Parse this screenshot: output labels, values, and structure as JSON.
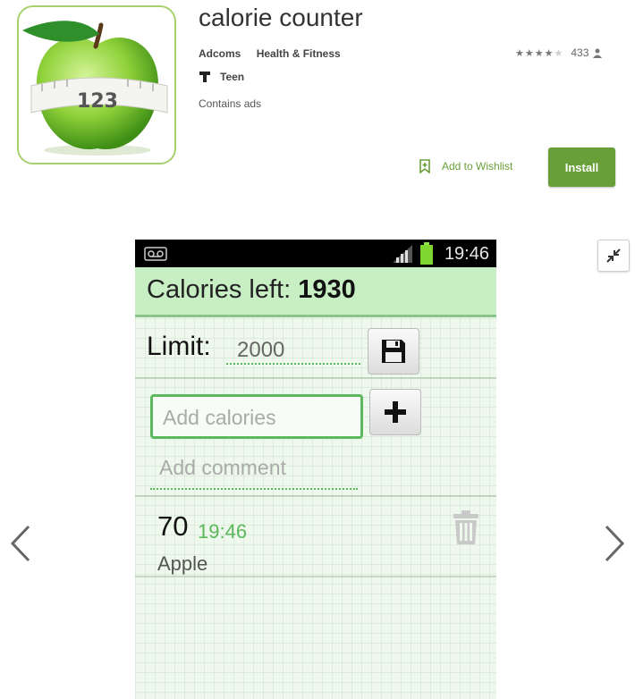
{
  "app": {
    "title": "calorie counter",
    "developer": "Adcoms",
    "category": "Health & Fitness",
    "content_rating": "Teen",
    "ads_notice": "Contains ads",
    "rating_stars": 3.5,
    "rating_count": "433",
    "wishlist_label": "Add to Wishlist",
    "install_label": "Install",
    "icon_text": "123",
    "accent_color": "#689f38"
  },
  "phone": {
    "status_time": "19:46",
    "header_label": "Calories left:",
    "calories_left": "1930",
    "limit_label": "Limit:",
    "limit_value": "2000",
    "add_calories_placeholder": "Add calories",
    "add_comment_placeholder": "Add comment",
    "entries": [
      {
        "calories": "70",
        "time": "19:46",
        "name": "Apple"
      }
    ]
  }
}
